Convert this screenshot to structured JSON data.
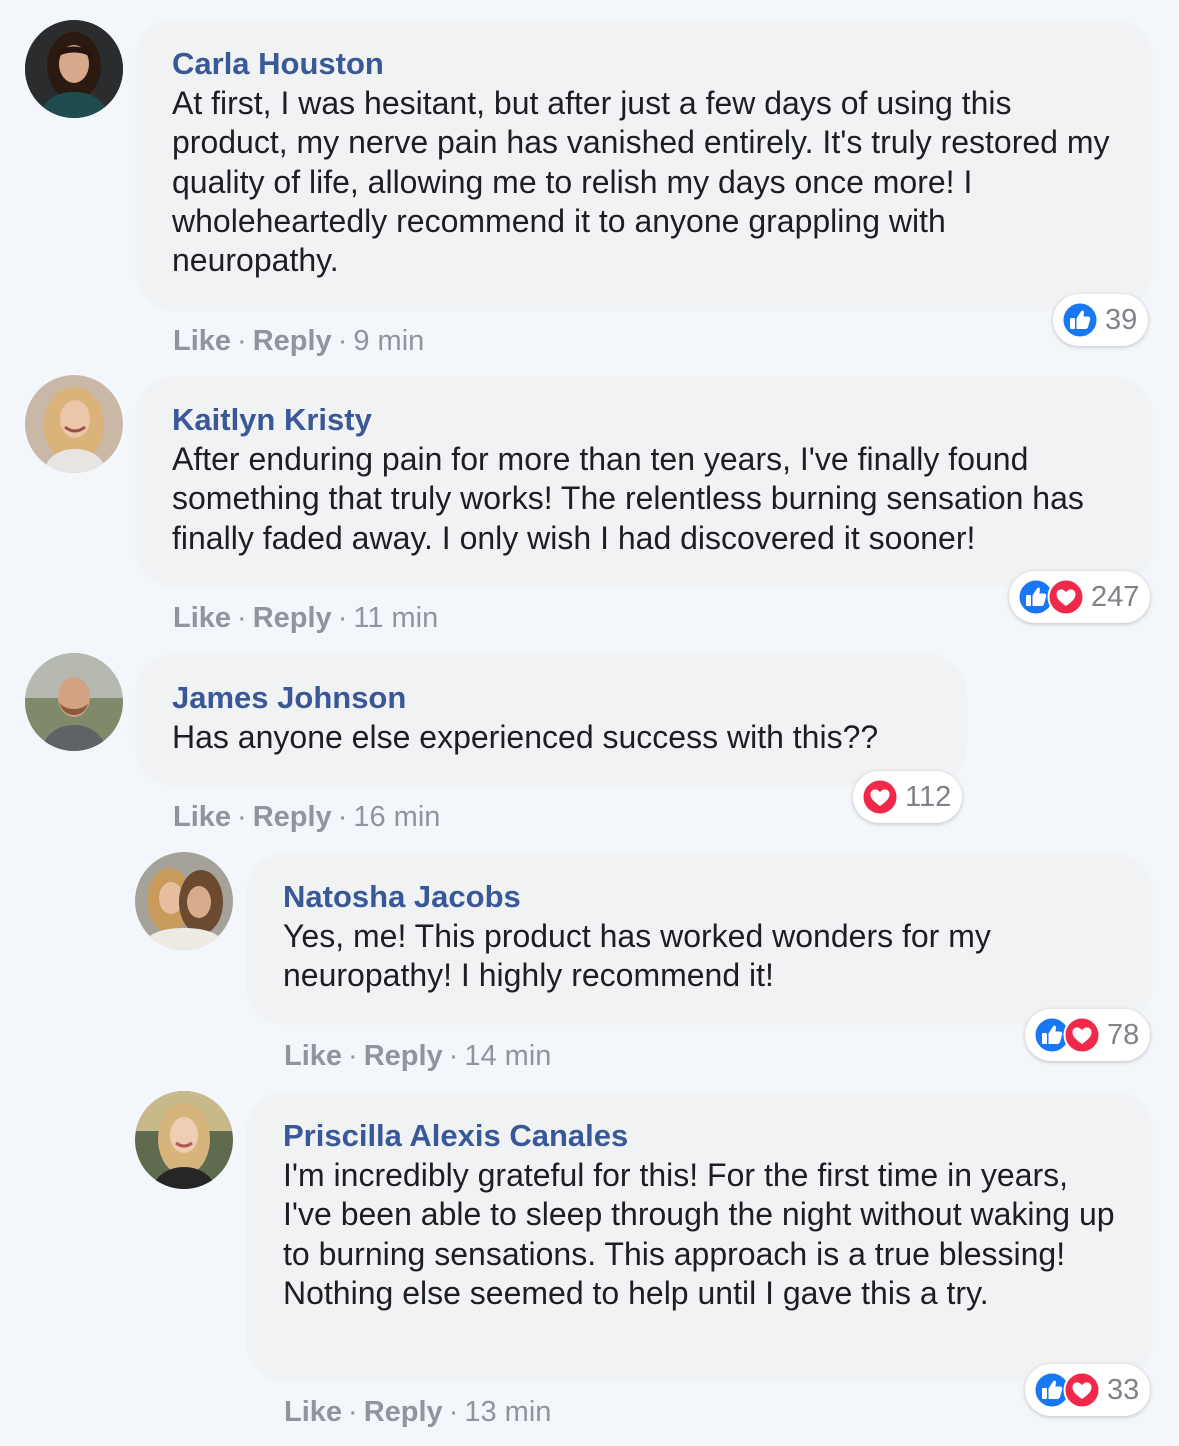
{
  "actions": {
    "like": "Like",
    "reply": "Reply",
    "separator": "·"
  },
  "colors": {
    "author": "#385898",
    "like_blue": "#1877f2",
    "love_red": "#f02849",
    "bubble": "#f1f2f4"
  },
  "comments": [
    {
      "author": "Carla Houston",
      "text": "At first, I was hesitant, but after just a few days of using this product, my nerve pain has vanished entirely. It's truly restored my quality of life, allowing me to relish my days once more! I wholeheartedly recommend it to anyone grappling with neuropathy.",
      "time": "9 min",
      "reactions": {
        "icons": [
          "like-icon"
        ],
        "count": "39"
      }
    },
    {
      "author": "Kaitlyn Kristy",
      "text": "After enduring pain for more than ten years, I've finally found something that truly works! The relentless burning sensation has finally faded away. I only wish I had discovered it sooner!",
      "time": "11 min",
      "reactions": {
        "icons": [
          "like-icon",
          "love-icon"
        ],
        "count": "247"
      }
    },
    {
      "author": "James Johnson",
      "text": "Has anyone else experienced success with this??",
      "time": "16 min",
      "reactions": {
        "icons": [
          "love-icon"
        ],
        "count": "112"
      }
    },
    {
      "author": "Natosha Jacobs",
      "text": "Yes, me! This product has worked wonders for my neuropathy! I highly recommend it!",
      "time": "14 min",
      "reactions": {
        "icons": [
          "like-icon",
          "love-icon"
        ],
        "count": "78"
      }
    },
    {
      "author": "Priscilla Alexis Canales",
      "text": "I'm incredibly grateful for this! For the first time in years, I've been able to sleep through the night without waking up to burning sensations. This approach is a true blessing! Nothing else seemed to help until I gave this a try.",
      "time": "13 min",
      "reactions": {
        "icons": [
          "like-icon",
          "love-icon"
        ],
        "count": "33"
      }
    }
  ]
}
